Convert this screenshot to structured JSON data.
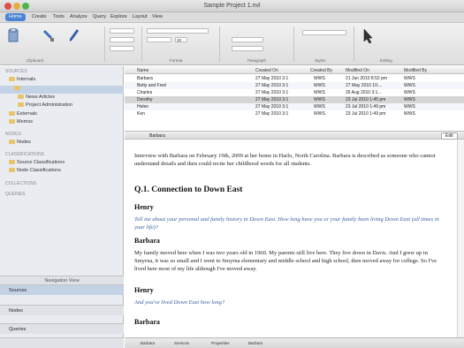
{
  "window": {
    "title": "Sample Project 1.nvl"
  },
  "tabs": [
    "Home",
    "Create",
    "Tools",
    "Analyze",
    "Query",
    "Explore",
    "Layout",
    "View"
  ],
  "ribbon": {
    "groups": [
      "Clipboard",
      "Format",
      "Paragraph",
      "Styles",
      "Editing"
    ],
    "font_size": "10",
    "find_placeholder": "Find"
  },
  "sidebar": {
    "sections": [
      {
        "label": "SOURCES",
        "kind": "head"
      },
      {
        "label": "Internals",
        "kind": "item"
      },
      {
        "label": "",
        "kind": "selected"
      },
      {
        "label": "News Articles",
        "kind": "sub"
      },
      {
        "label": "Project Administration",
        "kind": "sub"
      },
      {
        "label": "Externals",
        "kind": "item"
      },
      {
        "label": "Memos",
        "kind": "item"
      },
      {
        "label": "NODES",
        "kind": "head"
      },
      {
        "label": "Nodes",
        "kind": "item"
      },
      {
        "label": "CLASSIFICATIONS",
        "kind": "head"
      },
      {
        "label": "Source Classifications",
        "kind": "item"
      },
      {
        "label": "Node Classifications",
        "kind": "item"
      },
      {
        "label": "COLLECTIONS",
        "kind": "head"
      },
      {
        "label": "QUERIES",
        "kind": "head"
      }
    ],
    "navigation_header": "Navigation View",
    "bottom_items": [
      "Sources",
      "Nodes",
      "Queries"
    ]
  },
  "list": {
    "columns": [
      "Name",
      "Created On",
      "Created By",
      "Modified On",
      "Modified By"
    ],
    "rows": [
      {
        "name": "Barbara",
        "created": "27 May 2010 3:1",
        "by": "WWS",
        "modified": "21 Jun 2010 8:52 pm",
        "mod_by": "WWS"
      },
      {
        "name": "Betty and Fred",
        "created": "27 May 2010 3:1",
        "by": "WWS",
        "modified": "27 May 2010 10:...",
        "mod_by": "WWS"
      },
      {
        "name": "Charles",
        "created": "27 May 2010 3:1",
        "by": "WWS",
        "modified": "26 Aug 2010 3:1...",
        "mod_by": "WWS"
      },
      {
        "name": "Dorothy",
        "created": "27 May 2010 3:1",
        "by": "WWS",
        "modified": "23 Jul 2010 1:45 pm",
        "mod_by": "WWS"
      },
      {
        "name": "Helen",
        "created": "27 May 2010 3:1",
        "by": "WWS",
        "modified": "23 Jul 2010 1:49 pm",
        "mod_by": "WWS"
      },
      {
        "name": "Ken",
        "created": "27 May 2010 3:1",
        "by": "WWS",
        "modified": "23 Jul 2010 1:49 pm",
        "mod_by": "WWS"
      }
    ]
  },
  "document": {
    "tab_label": "Barbara",
    "edit_button": "Edit",
    "intro": "Interview with Barbara on February 19th, 2009 at her home in Harlo, North Carolina. Barbara is described as someone who cannot understand details and then could recite her childhood words for all students.",
    "heading": "Q.1. Connection to Down East",
    "blocks": [
      {
        "speaker": "Henry",
        "text": "Tell me about your personal and family history in Down East. How long have you or your family been living Down East (all times in your life)?",
        "kind": "q"
      },
      {
        "speaker": "Barbara",
        "text": "My family moved here when I was two years old in 1960. My parents still live here. They live down in Davis. And I grew up in Smyrna, it was so small and I went to Smyrna elementary and middle school and high school, then moved away for college. So I've lived here most of my life although I've moved away.",
        "kind": "a"
      },
      {
        "speaker": "Henry",
        "text": "And you've lived Down East how long?",
        "kind": "q"
      },
      {
        "speaker": "Barbara",
        "text": "",
        "kind": "a"
      }
    ]
  },
  "status_tabs": [
    "Barbara",
    "Services",
    "Properties",
    "Barbara"
  ],
  "colors": {
    "accent": "#4a84d2",
    "selection": "#c4d2e6",
    "question": "#355fa3"
  }
}
